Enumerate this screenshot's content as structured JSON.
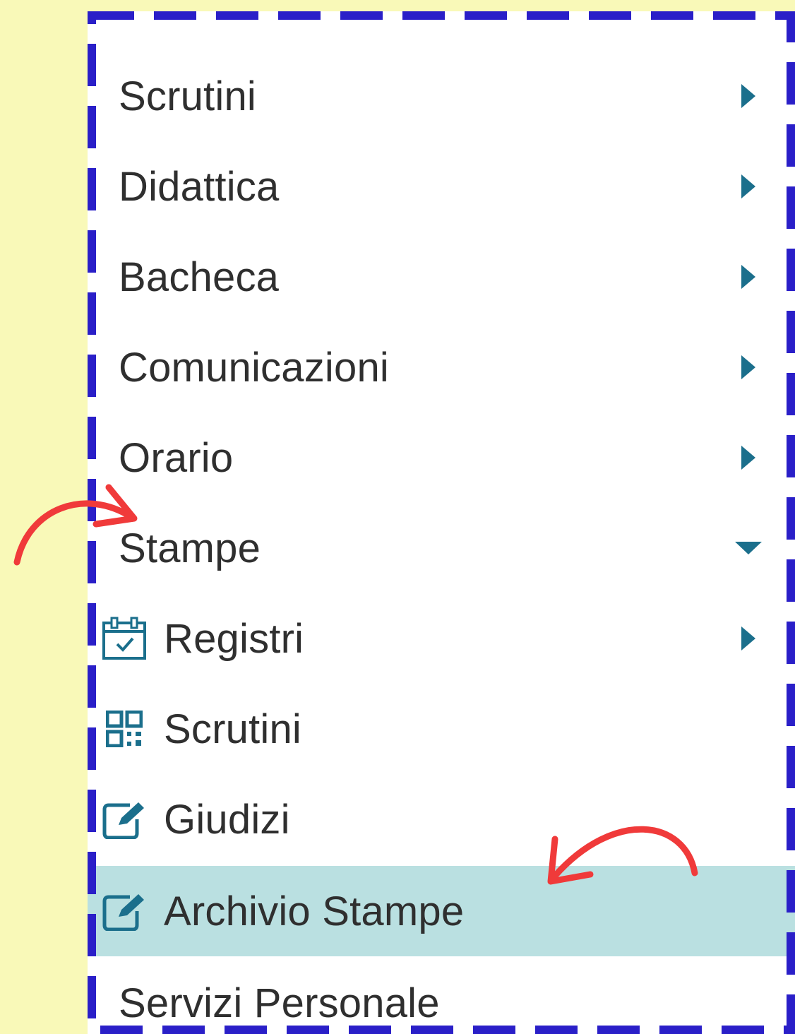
{
  "menu": {
    "items": [
      {
        "key": "scrutini",
        "label": "Scrutini",
        "chevron": "right"
      },
      {
        "key": "didattica",
        "label": "Didattica",
        "chevron": "right"
      },
      {
        "key": "bacheca",
        "label": "Bacheca",
        "chevron": "right"
      },
      {
        "key": "comunicazioni",
        "label": "Comunicazioni",
        "chevron": "right"
      },
      {
        "key": "orario",
        "label": "Orario",
        "chevron": "right"
      },
      {
        "key": "stampe",
        "label": "Stampe",
        "chevron": "down",
        "expanded": true
      }
    ],
    "submenu": [
      {
        "key": "registri",
        "label": "Registri",
        "icon": "calendar-check-icon",
        "chevron": "right"
      },
      {
        "key": "scrutini",
        "label": "Scrutini",
        "icon": "qr-code-icon"
      },
      {
        "key": "giudizi",
        "label": "Giudizi",
        "icon": "edit-icon"
      },
      {
        "key": "archivio-stampe",
        "label": "Archivio Stampe",
        "icon": "edit-icon",
        "highlighted": true
      }
    ],
    "trailing": {
      "label": "Servizi Personale"
    }
  },
  "colors": {
    "background": "#f9f9b8",
    "frame_dash": "#2a1fc8",
    "accent": "#1b6f8c",
    "highlight": "#bae0e1",
    "annotation_arrow": "#f03a3a",
    "text": "#2f2f2f"
  }
}
